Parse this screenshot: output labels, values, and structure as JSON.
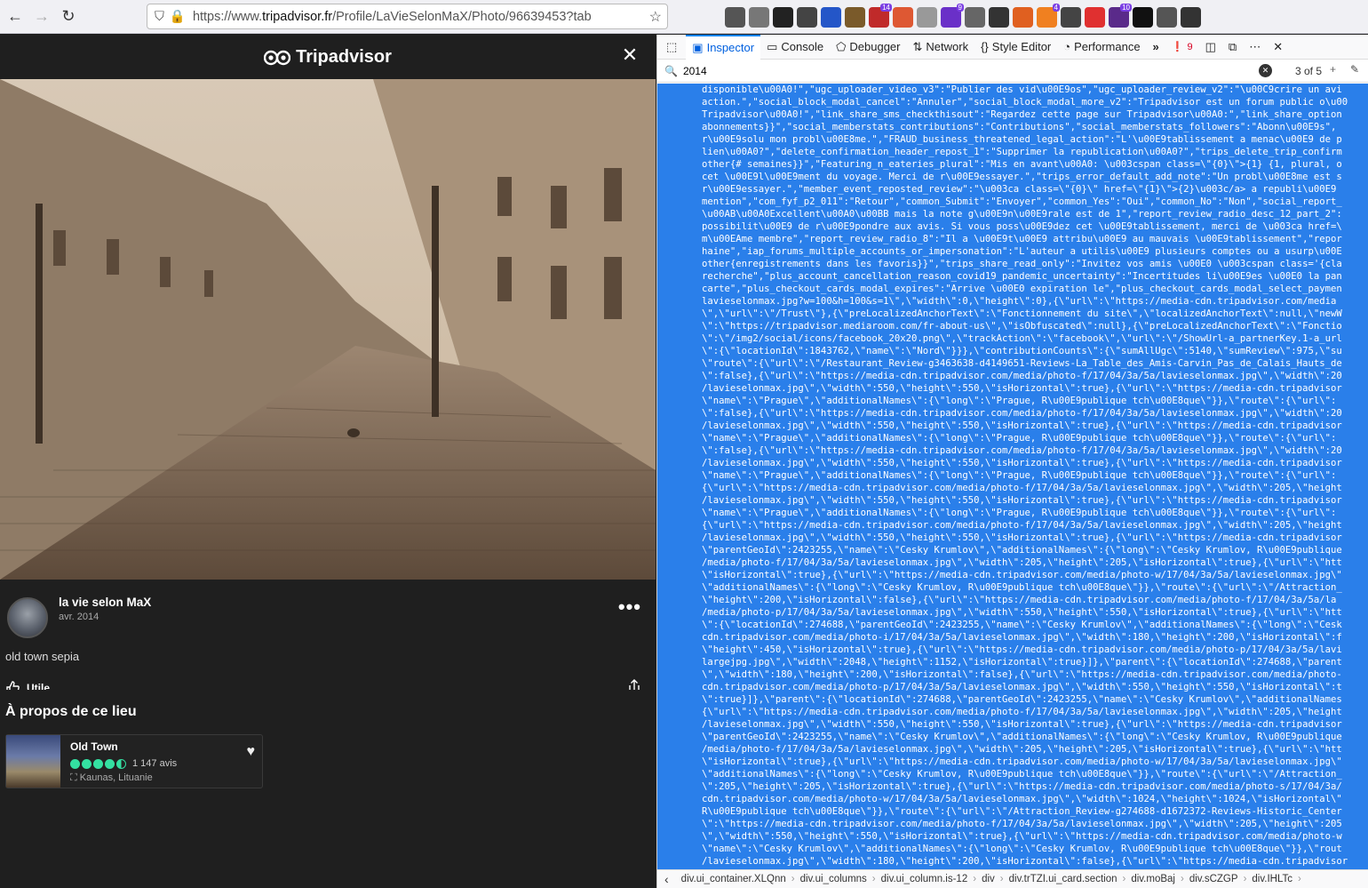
{
  "browser": {
    "url_prefix": "https://www.",
    "url_domain": "tripadvisor.fr",
    "url_rest": "/Profile/LaVieSelonMaX/Photo/96639453?tab"
  },
  "extensions": [
    {
      "name": "download-icon",
      "color": "#555",
      "badge": ""
    },
    {
      "name": "pocket-icon",
      "color": "#777",
      "badge": ""
    },
    {
      "name": "h-icon",
      "color": "#222",
      "badge": ""
    },
    {
      "name": "git-icon",
      "color": "#444",
      "badge": ""
    },
    {
      "name": "ext-blue-icon",
      "color": "#2456c8",
      "badge": ""
    },
    {
      "name": "ext-cookie-icon",
      "color": "#7a5a2a",
      "badge": ""
    },
    {
      "name": "ext-red-icon",
      "color": "#c02a2a",
      "badge": "14"
    },
    {
      "name": "duckduckgo-icon",
      "color": "#de5833",
      "badge": ""
    },
    {
      "name": "puzzle-icon",
      "color": "#999",
      "badge": ""
    },
    {
      "name": "ext-purple-icon",
      "color": "#6a30c8",
      "badge": "9"
    },
    {
      "name": "trash-icon",
      "color": "#666",
      "badge": ""
    },
    {
      "name": "ext-hat-icon",
      "color": "#333",
      "badge": ""
    },
    {
      "name": "ext-ball-icon",
      "color": "#e06020",
      "badge": ""
    },
    {
      "name": "ext-orange-icon",
      "color": "#f08020",
      "badge": "4"
    },
    {
      "name": "eyedropper-icon",
      "color": "#444",
      "badge": ""
    },
    {
      "name": "camera-icon",
      "color": "#e03030",
      "badge": ""
    },
    {
      "name": "ext-grid-icon",
      "color": "#5a2a8a",
      "badge": "10"
    },
    {
      "name": "ext-color-icon",
      "color": "#111",
      "badge": ""
    },
    {
      "name": "extensions-icon",
      "color": "#555",
      "badge": ""
    },
    {
      "name": "menu-icon",
      "color": "#333",
      "badge": ""
    }
  ],
  "left": {
    "logo": "Tripadvisor",
    "close": "✕",
    "user": "la vie selon MaX",
    "date": "avr. 2014",
    "more": "•••",
    "caption": "old town sepia",
    "helpful": "Utile",
    "about": "À propos de ce lieu",
    "place": {
      "name": "Old Town",
      "reviews": "1 147 avis",
      "location": "Kaunas, Lituanie",
      "rating": 4.5
    }
  },
  "devtools": {
    "tabs": [
      "Inspector",
      "Console",
      "Debugger",
      "Network",
      "Style Editor",
      "Performance"
    ],
    "errors": "9",
    "search": "2014",
    "count": "3 of 5",
    "code": [
      "disponible\\u00A0!\",\"ugc_uploader_video_v3\":\"Publier des vid\\u00E9os\",\"ugc_uploader_review_v2\":\"\\u00C9crire un avi",
      "action.\",\"social_block_modal_cancel\":\"Annuler\",\"social_block_modal_more_v2\":\"Tripadvisor est un forum public o\\u00",
      "Tripadvisor\\u00A0!\",\"link_share_sms_checkthisout\":\"Regardez cette page sur Tripadvisor\\u00A0:\",\"link_share_option",
      "abonnements}}\",\"social_memberstats_contributions\":\"Contributions\",\"social_memberstats_followers\":\"Abonn\\u00E9s\",",
      "r\\u00E9solu mon probl\\u00E8me.\",\"FRAUD_business_threatened_legal_action\":\"L'\\u00E9tablissement a menac\\u00E9 de p",
      "lien\\u00A0?\",\"delete_confirmation_header_repost_1\":\"Supprimer la republication\\u00A0?\",\"trips_delete_trip_confirm",
      "other{# semaines}}\",\"Featuring_n_eateries_plural\":\"Mis en avant\\u00A0: \\u003cspan class=\\\"{0}\\\">{1} {1, plural, o",
      "cet \\u00E9l\\u00E9ment du voyage. Merci de r\\u00E9essayer.\",\"trips_error_default_add_note\":\"Un probl\\u00E8me est s",
      "r\\u00E9essayer.\",\"member_event_reposted_review\":\"\\u003ca class=\\\"{0}\\\" href=\\\"{1}\\\">{2}\\u003c/a> a republi\\u00E9",
      "mention\",\"com_fyf_p2_011\":\"Retour\",\"common_Submit\":\"Envoyer\",\"common_Yes\":\"Oui\",\"common_No\":\"Non\",\"social_report_",
      "\\u00AB\\u00A0Excellent\\u00A0\\u00BB mais la note g\\u00E9n\\u00E9rale est de 1\",\"report_review_radio_desc_12_part_2\":",
      "possibilit\\u00E9 de r\\u00E9pondre aux avis. Si vous poss\\u00E9dez cet \\u00E9tablissement, merci de \\u003ca href=\\",
      "m\\u00EAme membre\",\"report_review_radio_8\":\"Il a \\u00E9t\\u00E9 attribu\\u00E9 au mauvais \\u00E9tablissement\",\"repor",
      "haine\",\"iap_forums_multiple_accounts_or_impersonation\":\"L'auteur a utilis\\u00E9 plusieurs comptes ou a usurp\\u00E",
      "other{enregistrements dans les favoris}}\",\"trips_share_read_only\":\"Invitez vos amis \\u00E0 \\u003cspan class='{cla",
      "recherche\",\"plus_account_cancellation_reason_covid19_pandemic_uncertainty\":\"Incertitudes li\\u00E9es \\u00E0 la pan",
      "carte\",\"plus_checkout_cards_modal_expires\":\"Arrive \\u00E0 expiration le\",\"plus_checkout_cards_modal_select_paymen",
      "lavieselonmax.jpg?w=100&h=100&s=1\\\",\\\"width\\\":0,\\\"height\\\":0},{\\\"url\\\":\\\"https://media-cdn.tripadvisor.com/media",
      "\\\",\\\"url\\\":\\\"/Trust\\\"},{\\\"preLocalizedAnchorText\\\":\\\"Fonctionnement du site\\\",\\\"localizedAnchorText\\\":null,\\\"newW",
      "\\\":\\\"https://tripadvisor.mediaroom.com/fr-about-us\\\",\\\"isObfuscated\\\":null},{\\\"preLocalizedAnchorText\\\":\\\"Fonctio",
      "\\\":\\\"/img2/social/icons/facebook_20x20.png\\\",\\\"trackAction\\\":\\\"facebook\\\",\\\"url\\\":\\\"/ShowUrl-a_partnerKey.1-a_url",
      "\\\":{\\\"locationId\\\":1843762,\\\"name\\\":\\\"Nord\\\"}}},\\\"contributionCounts\\\":{\\\"sumAllUgc\\\":5140,\\\"sumReview\\\":975,\\\"su",
      "\\\"route\\\":{\\\"url\\\":\\\"/Restaurant_Review-g3463638-d4149651-Reviews-La_Table_des_Amis-Carvin_Pas_de_Calais_Hauts_de",
      "\\\":false},{\\\"url\\\":\\\"https://media-cdn.tripadvisor.com/media/photo-f/17/04/3a/5a/lavieselonmax.jpg\\\",\\\"width\\\":20",
      "/lavieselonmax.jpg\\\",\\\"width\\\":550,\\\"height\\\":550,\\\"isHorizontal\\\":true},{\\\"url\\\":\\\"https://media-cdn.tripadvisor",
      "\\\"name\\\":\\\"Prague\\\",\\\"additionalNames\\\":{\\\"long\\\":\\\"Prague, R\\u00E9publique tch\\u00E8que\\\"}},\\\"route\\\":{\\\"url\\\":",
      "\\\":false},{\\\"url\\\":\\\"https://media-cdn.tripadvisor.com/media/photo-f/17/04/3a/5a/lavieselonmax.jpg\\\",\\\"width\\\":20",
      "/lavieselonmax.jpg\\\",\\\"width\\\":550,\\\"height\\\":550,\\\"isHorizontal\\\":true},{\\\"url\\\":\\\"https://media-cdn.tripadvisor",
      "\\\"name\\\":\\\"Prague\\\",\\\"additionalNames\\\":{\\\"long\\\":\\\"Prague, R\\u00E9publique tch\\u00E8que\\\"}},\\\"route\\\":{\\\"url\\\":",
      "\\\":false},{\\\"url\\\":\\\"https://media-cdn.tripadvisor.com/media/photo-f/17/04/3a/5a/lavieselonmax.jpg\\\",\\\"width\\\":20",
      "/lavieselonmax.jpg\\\",\\\"width\\\":550,\\\"height\\\":550,\\\"isHorizontal\\\":true},{\\\"url\\\":\\\"https://media-cdn.tripadvisor",
      "\\\"name\\\":\\\"Prague\\\",\\\"additionalNames\\\":{\\\"long\\\":\\\"Prague, R\\u00E9publique tch\\u00E8que\\\"}},\\\"route\\\":{\\\"url\\\":",
      "{\\\"url\\\":\\\"https://media-cdn.tripadvisor.com/media/photo-f/17/04/3a/5a/lavieselonmax.jpg\\\",\\\"width\\\":205,\\\"height",
      "/lavieselonmax.jpg\\\",\\\"width\\\":550,\\\"height\\\":550,\\\"isHorizontal\\\":true},{\\\"url\\\":\\\"https://media-cdn.tripadvisor",
      "\\\"name\\\":\\\"Prague\\\",\\\"additionalNames\\\":{\\\"long\\\":\\\"Prague, R\\u00E9publique tch\\u00E8que\\\"}},\\\"route\\\":{\\\"url\\\":",
      "{\\\"url\\\":\\\"https://media-cdn.tripadvisor.com/media/photo-f/17/04/3a/5a/lavieselonmax.jpg\\\",\\\"width\\\":205,\\\"height",
      "/lavieselonmax.jpg\\\",\\\"width\\\":550,\\\"height\\\":550,\\\"isHorizontal\\\":true},{\\\"url\\\":\\\"https://media-cdn.tripadvisor",
      "\\\"parentGeoId\\\":2423255,\\\"name\\\":\\\"Cesky Krumlov\\\",\\\"additionalNames\\\":{\\\"long\\\":\\\"Cesky Krumlov, R\\u00E9publique",
      "/media/photo-f/17/04/3a/5a/lavieselonmax.jpg\\\",\\\"width\\\":205,\\\"height\\\":205,\\\"isHorizontal\\\":true},{\\\"url\\\":\\\"htt",
      "\\\"isHorizontal\\\":true},{\\\"url\\\":\\\"https://media-cdn.tripadvisor.com/media/photo-w/17/04/3a/5a/lavieselonmax.jpg\\\"",
      "\\\"additionalNames\\\":{\\\"long\\\":\\\"Cesky Krumlov, R\\u00E9publique tch\\u00E8que\\\"}},\\\"route\\\":{\\\"url\\\":\\\"/Attraction_",
      "\\\"height\\\":200,\\\"isHorizontal\\\":false},{\\\"url\\\":\\\"https://media-cdn.tripadvisor.com/media/photo-f/17/04/3a/5a/la",
      "/media/photo-p/17/04/3a/5a/lavieselonmax.jpg\\\",\\\"width\\\":550,\\\"height\\\":550,\\\"isHorizontal\\\":true},{\\\"url\\\":\\\"htt",
      "\\\":{\\\"locationId\\\":274688,\\\"parentGeoId\\\":2423255,\\\"name\\\":\\\"Cesky Krumlov\\\",\\\"additionalNames\\\":{\\\"long\\\":\\\"Cesk",
      "cdn.tripadvisor.com/media/photo-i/17/04/3a/5a/lavieselonmax.jpg\\\",\\\"width\\\":180,\\\"height\\\":200,\\\"isHorizontal\\\":f",
      "\\\"height\\\":450,\\\"isHorizontal\\\":true},{\\\"url\\\":\\\"https://media-cdn.tripadvisor.com/media/photo-p/17/04/3a/5a/lavi",
      "largejpg.jpg\\\",\\\"width\\\":2048,\\\"height\\\":1152,\\\"isHorizontal\\\":true}]},\\\"parent\\\":{\\\"locationId\\\":274688,\\\"parent",
      "\\\",\\\"width\\\":180,\\\"height\\\":200,\\\"isHorizontal\\\":false},{\\\"url\\\":\\\"https://media-cdn.tripadvisor.com/media/photo-",
      "cdn.tripadvisor.com/media/photo-p/17/04/3a/5a/lavieselonmax.jpg\\\",\\\"width\\\":550,\\\"height\\\":550,\\\"isHorizontal\\\":t",
      "\\\":true}]},\\\"parent\\\":{\\\"locationId\\\":274688,\\\"parentGeoId\\\":2423255,\\\"name\\\":\\\"Cesky Krumlov\\\",\\\"additionalNames",
      "{\\\"url\\\":\\\"https://media-cdn.tripadvisor.com/media/photo-f/17/04/3a/5a/lavieselonmax.jpg\\\",\\\"width\\\":205,\\\"height",
      "/lavieselonmax.jpg\\\",\\\"width\\\":550,\\\"height\\\":550,\\\"isHorizontal\\\":true},{\\\"url\\\":\\\"https://media-cdn.tripadvisor",
      "\\\"parentGeoId\\\":2423255,\\\"name\\\":\\\"Cesky Krumlov\\\",\\\"additionalNames\\\":{\\\"long\\\":\\\"Cesky Krumlov, R\\u00E9publique",
      "/media/photo-f/17/04/3a/5a/lavieselonmax.jpg\\\",\\\"width\\\":205,\\\"height\\\":205,\\\"isHorizontal\\\":true},{\\\"url\\\":\\\"htt",
      "\\\"isHorizontal\\\":true},{\\\"url\\\":\\\"https://media-cdn.tripadvisor.com/media/photo-w/17/04/3a/5a/lavieselonmax.jpg\\\"",
      "\\\"additionalNames\\\":{\\\"long\\\":\\\"Cesky Krumlov, R\\u00E9publique tch\\u00E8que\\\"}},\\\"route\\\":{\\\"url\\\":\\\"/Attraction_",
      "\\\":205,\\\"height\\\":205,\\\"isHorizontal\\\":true},{\\\"url\\\":\\\"https://media-cdn.tripadvisor.com/media/photo-s/17/04/3a/",
      "cdn.tripadvisor.com/media/photo-w/17/04/3a/5a/lavieselonmax.jpg\\\",\\\"width\\\":1024,\\\"height\\\":1024,\\\"isHorizontal\\\"",
      "R\\u00E9publique tch\\u00E8que\\\"}},\\\"route\\\":{\\\"url\\\":\\\"/Attraction_Review-g274688-d1672372-Reviews-Historic_Center",
      "\\\":\\\"https://media-cdn.tripadvisor.com/media/photo-f/17/04/3a/5a/lavieselonmax.jpg\\\",\\\"width\\\":205,\\\"height\\\":205",
      "\\\",\\\"width\\\":550,\\\"height\\\":550,\\\"isHorizontal\\\":true},{\\\"url\\\":\\\"https://media-cdn.tripadvisor.com/media/photo-w",
      "\\\"name\\\":\\\"Cesky Krumlov\\\",\\\"additionalNames\\\":{\\\"long\\\":\\\"Cesky Krumlov, R\\u00E9publique tch\\u00E8que\\\"}},\\\"rout",
      "/lavieselonmax.jpg\\\",\\\"width\\\":180,\\\"height\\\":200,\\\"isHorizontal\\\":false},{\\\"url\\\":\\\"https://media-cdn.tripadvisor"
    ],
    "breadcrumbs": [
      "div.ui_container.XLQnn",
      "div.ui_columns",
      "div.ui_column.is-12",
      "div",
      "div.trTZI.ui_card.section",
      "div.moBaj",
      "div.sCZGP",
      "div.IHLTc"
    ]
  }
}
